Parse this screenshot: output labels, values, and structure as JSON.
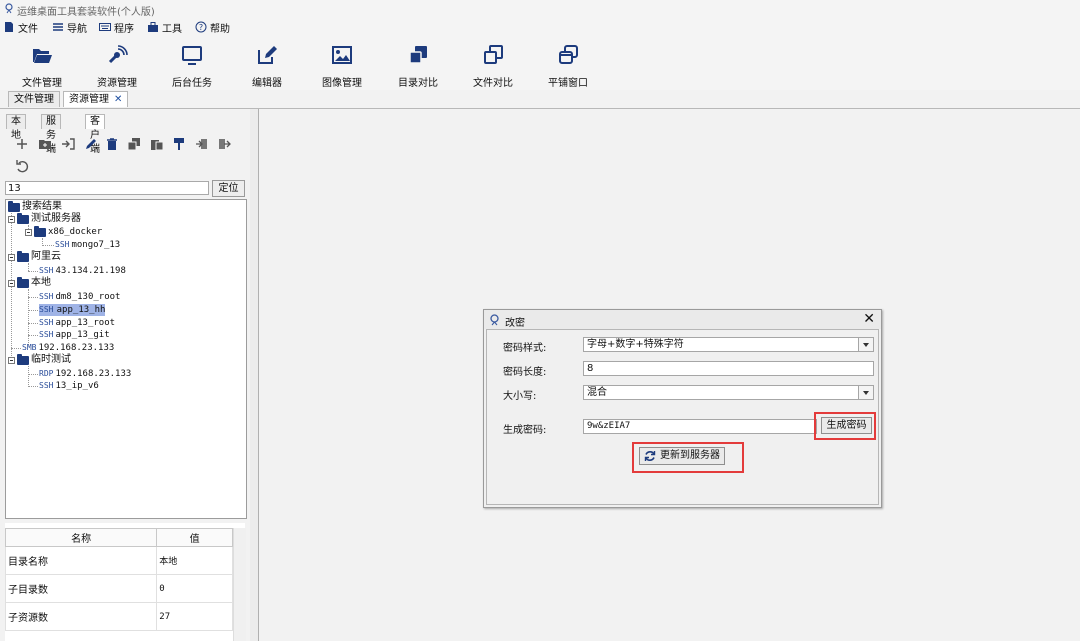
{
  "app": {
    "title": "运维桌面工具套装软件(个人版)"
  },
  "menu": [
    {
      "label": "文件",
      "icon": "file-icon"
    },
    {
      "label": "导航",
      "icon": "list-icon"
    },
    {
      "label": "程序",
      "icon": "keyboard-icon"
    },
    {
      "label": "工具",
      "icon": "toolbox-icon"
    },
    {
      "label": "帮助",
      "icon": "help-icon"
    }
  ],
  "toolbar": [
    {
      "label": "文件管理",
      "icon": "folder-open-icon"
    },
    {
      "label": "资源管理",
      "icon": "satellite-icon"
    },
    {
      "label": "后台任务",
      "icon": "monitor-icon"
    },
    {
      "label": "编辑器",
      "icon": "edit-icon"
    },
    {
      "label": "图像管理",
      "icon": "image-icon"
    },
    {
      "label": "目录对比",
      "icon": "clone-solid-icon"
    },
    {
      "label": "文件对比",
      "icon": "clone-outline-icon"
    },
    {
      "label": "平铺窗口",
      "icon": "windows-icon"
    }
  ],
  "tabs": [
    {
      "label": "文件管理",
      "active": false
    },
    {
      "label": "资源管理",
      "active": true,
      "close": "✕"
    }
  ],
  "subtabs": [
    {
      "label": "本地",
      "active": false
    },
    {
      "label": "服务端",
      "active": false
    },
    {
      "label": "客户端",
      "active": true
    }
  ],
  "search": {
    "value": "13",
    "locate_label": "定位"
  },
  "tree": [
    {
      "label": "搜索结果",
      "type": "folder"
    },
    {
      "label": "测试服务器",
      "type": "folder"
    },
    {
      "label": "x86_docker",
      "type": "folder"
    },
    {
      "label": "mongo7_13",
      "type": "leaf",
      "proto": "SSH"
    },
    {
      "label": "阿里云",
      "type": "folder"
    },
    {
      "label": "43.134.21.198",
      "type": "leaf",
      "proto": "SSH"
    },
    {
      "label": "本地",
      "type": "folder"
    },
    {
      "label": "dm8_130_root",
      "type": "leaf",
      "proto": "SSH"
    },
    {
      "label": "app_13_hh",
      "type": "leaf",
      "proto": "SSH",
      "selected": true
    },
    {
      "label": "app_13_root",
      "type": "leaf",
      "proto": "SSH"
    },
    {
      "label": "app_13_git",
      "type": "leaf",
      "proto": "SSH"
    },
    {
      "label": "192.168.23.133",
      "type": "leaf",
      "proto": "SMB"
    },
    {
      "label": "临时测试",
      "type": "folder"
    },
    {
      "label": "192.168.23.133",
      "type": "leaf",
      "proto": "RDP"
    },
    {
      "label": "13_ip_v6",
      "type": "leaf",
      "proto": "SSH"
    }
  ],
  "props": {
    "headers": [
      "名称",
      "值"
    ],
    "rows": [
      [
        "目录名称",
        "本地"
      ],
      [
        "子目录数",
        "0"
      ],
      [
        "子资源数",
        "27"
      ]
    ]
  },
  "dialog": {
    "title": "改密",
    "close": "✕",
    "fields": [
      {
        "label": "密码样式:",
        "value": "字母+数字+特殊字符",
        "dropdown": true
      },
      {
        "label": "密码长度:",
        "value": "8",
        "dropdown": false
      },
      {
        "label": "大小写:",
        "value": "混合",
        "dropdown": true
      },
      {
        "label": "生成密码:",
        "value": "9w&zEIA7",
        "dropdown": false
      }
    ],
    "generate_label": "生成密码",
    "update_label": "更新到服务器"
  },
  "colors": {
    "highlight": "#e33b3b",
    "icon": "#1d3b7d",
    "selection": "#9fb3e6"
  }
}
